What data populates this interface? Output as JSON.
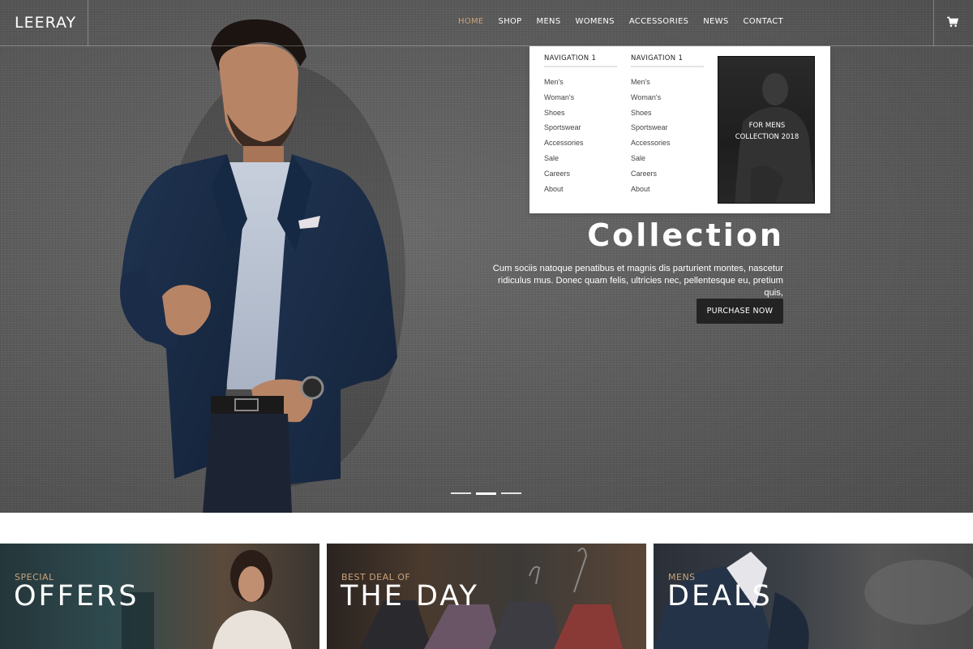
{
  "header": {
    "logo": "LEERAY",
    "nav": [
      "HOME",
      "SHOP",
      "MENS",
      "WOMENS",
      "ACCESSORIES",
      "NEWS",
      "CONTACT"
    ],
    "active_nav": "HOME",
    "cart_icon": "cart-icon"
  },
  "mega_menu": {
    "columns": [
      {
        "heading": "NAVIGATION 1",
        "links": [
          "Men's",
          "Woman's",
          "Shoes",
          "Sportswear",
          "Accessories",
          "Sale",
          "Careers",
          "About"
        ]
      },
      {
        "heading": "NAVIGATION 1",
        "links": [
          "Men's",
          "Woman's",
          "Shoes",
          "Sportswear",
          "Accessories",
          "Sale",
          "Careers",
          "About"
        ]
      }
    ],
    "promo": {
      "line1": "FOR MENS",
      "line2": "COLLECTION 2018"
    }
  },
  "hero": {
    "title": "Collection",
    "description": "Cum sociis natoque penatibus et magnis dis parturient montes, nascetur ridiculus mus. Donec quam felis, ultricies nec, pellentesque eu, pretium quis,",
    "button": "PURCHASE NOW",
    "slides": 3,
    "active_slide": 2
  },
  "banners": [
    {
      "subtitle": "SPECIAL",
      "title": "OFFERS"
    },
    {
      "subtitle": "BEST DEAL OF",
      "title": "THE DAY"
    },
    {
      "subtitle": "MENS",
      "title": "DEALS"
    }
  ],
  "colors": {
    "accent": "#c9a37a",
    "hero_bg": "#5e5e5e",
    "button_bg": "#232323"
  }
}
